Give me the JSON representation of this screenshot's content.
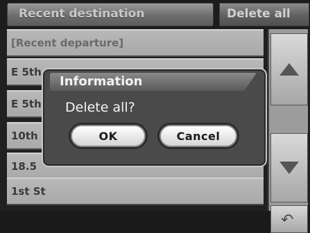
{
  "header": {
    "title": "Recent destination",
    "delete_all_label": "Delete all"
  },
  "list": {
    "items": [
      {
        "label": "[Recent departure]"
      },
      {
        "label": "E 5th St"
      },
      {
        "label": "E 5th St"
      },
      {
        "label": "10th St"
      },
      {
        "label": "18.5"
      },
      {
        "label": "1st St"
      }
    ]
  },
  "side": {
    "up_icon": "triangle-up",
    "down_icon": "triangle-down",
    "back_icon": "return-arrow"
  },
  "dialog": {
    "title": "Information",
    "message": "Delete all?",
    "ok_label": "OK",
    "cancel_label": "Cancel"
  },
  "colors": {
    "background": "#202020",
    "list_row": "#b0b0b0",
    "dialog_bg": "#4a4a4a",
    "button_bg": "#f0f0f0"
  }
}
